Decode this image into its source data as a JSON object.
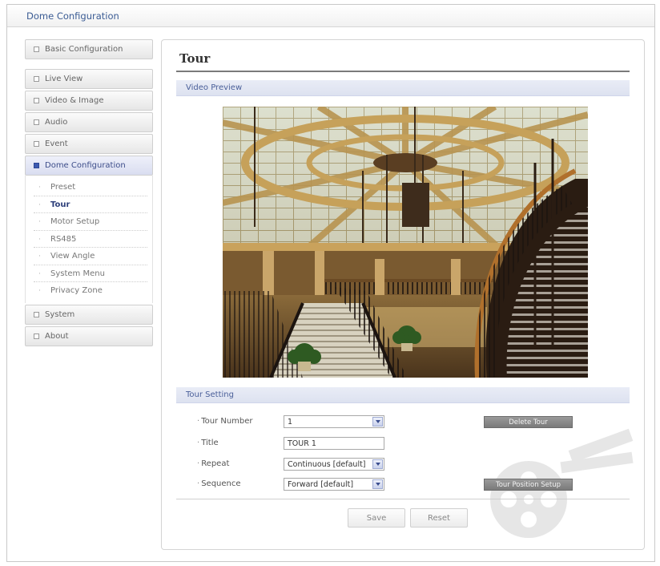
{
  "header": {
    "title": "Dome Configuration"
  },
  "sidebar": {
    "items": [
      {
        "label": "Basic Configuration"
      },
      {
        "label": "Live View"
      },
      {
        "label": "Video & Image"
      },
      {
        "label": "Audio"
      },
      {
        "label": "Event"
      },
      {
        "label": "Dome Configuration"
      },
      {
        "label": "System"
      },
      {
        "label": "About"
      }
    ],
    "submenu": [
      {
        "label": "Preset"
      },
      {
        "label": "Tour"
      },
      {
        "label": "Motor Setup"
      },
      {
        "label": "RS485"
      },
      {
        "label": "View Angle"
      },
      {
        "label": "System Menu"
      },
      {
        "label": "Privacy Zone"
      }
    ]
  },
  "main": {
    "title": "Tour",
    "video_preview_label": "Video Preview",
    "tour_setting_label": "Tour Setting",
    "form": {
      "tour_number": {
        "label": "Tour Number",
        "value": "1"
      },
      "title": {
        "label": "Title",
        "value": "TOUR 1"
      },
      "repeat": {
        "label": "Repeat",
        "value": "Continuous [default]"
      },
      "sequence": {
        "label": "Sequence",
        "value": "Forward [default]"
      }
    },
    "delete_tour_label": "Delete Tour",
    "tour_position_setup_label": "Tour Position Setup",
    "save_label": "Save",
    "reset_label": "Reset"
  },
  "colors": {
    "accent": "#3d5ab0",
    "section_bar": "#e3e7f3",
    "dark_button": "#888888"
  },
  "icons": {
    "nav_bullet": "square-bullet-icon",
    "select_arrow": "chevron-down-icon",
    "watermark": "film-camera-icon"
  }
}
